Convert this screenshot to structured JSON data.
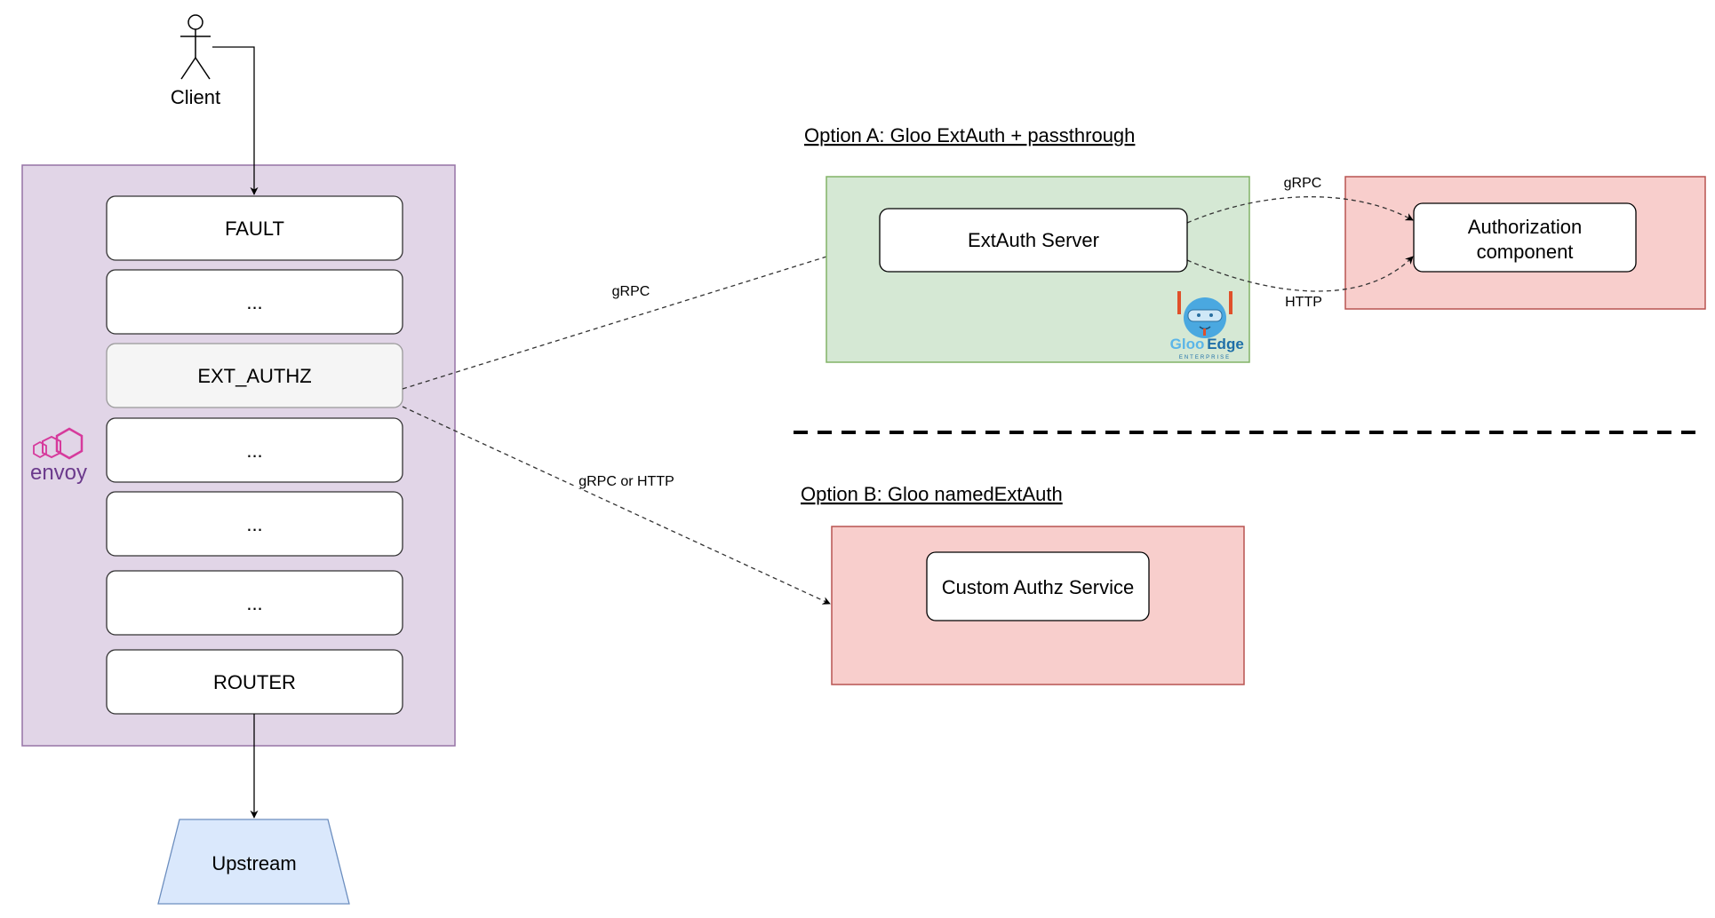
{
  "client": {
    "label": "Client",
    "icon": "actor-icon"
  },
  "envoy": {
    "logo_text": "envoy",
    "logo_icon": "envoy-logo-icon",
    "filters": [
      {
        "label": "FAULT",
        "highlighted": false
      },
      {
        "label": "...",
        "highlighted": false
      },
      {
        "label": "EXT_AUTHZ",
        "highlighted": true
      },
      {
        "label": "...",
        "highlighted": false
      },
      {
        "label": "...",
        "highlighted": false
      },
      {
        "label": "...",
        "highlighted": false
      },
      {
        "label": "ROUTER",
        "highlighted": false
      }
    ]
  },
  "upstream": {
    "label": "Upstream"
  },
  "edges": {
    "to_option_a": "gRPC",
    "to_option_b": "gRPC or HTTP",
    "extauth_to_authz_top": "gRPC",
    "extauth_to_authz_bottom": "HTTP"
  },
  "option_a": {
    "title": "Option A: Gloo ExtAuth + passthrough",
    "extauth_server": "ExtAuth Server",
    "authz_component_line1": "Authorization",
    "authz_component_line2": "component",
    "gloo_logo": {
      "brand": "Gloo",
      "product": "Edge",
      "edition": "ENTERPRISE",
      "icon": "gloo-mascot-icon"
    }
  },
  "option_b": {
    "title": "Option B: Gloo namedExtAuth",
    "custom_service": "Custom Authz Service"
  },
  "colors": {
    "envoy_bg": "#e1d5e7",
    "envoy_border": "#9673a6",
    "green_bg": "#d5e8d4",
    "green_border": "#82b366",
    "red_bg": "#f8cecc",
    "red_border": "#b85450",
    "upstream_bg": "#dae8fc",
    "upstream_border": "#6c8ebf",
    "highlight_bg": "#f5f5f5",
    "envoy_brand": "#d63a9c"
  }
}
